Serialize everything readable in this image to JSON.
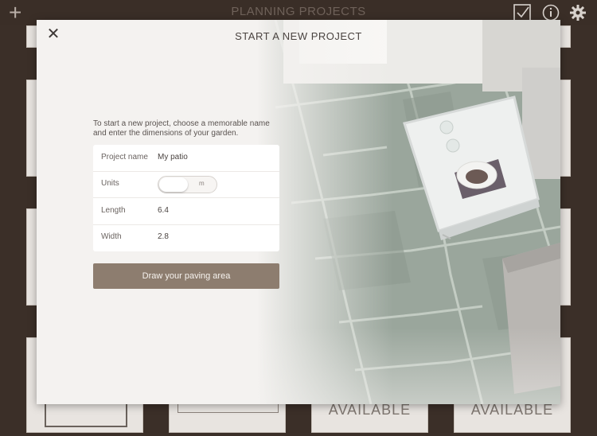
{
  "topbar": {
    "title": "PLANNING PROJECTS",
    "icons": [
      "plus-icon",
      "checkbox-icon",
      "info-icon",
      "gear-icon"
    ]
  },
  "background_tiles": {
    "available_label": "AVAILABLE"
  },
  "modal": {
    "title": "START A NEW PROJECT",
    "intro": "To start a new project, choose a memorable name and enter the dimensions of your garden.",
    "fields": {
      "project_name_label": "Project name",
      "project_name_value": "My patio",
      "units_label": "Units",
      "units_option": "m",
      "length_label": "Length",
      "length_value": "6.4",
      "width_label": "Width",
      "width_value": "2.8"
    },
    "draw_button": "Draw your paving area"
  },
  "colors": {
    "frame": "#3b2f28",
    "button": "#8d7d6f",
    "modal_bg": "#f4f2f0"
  }
}
